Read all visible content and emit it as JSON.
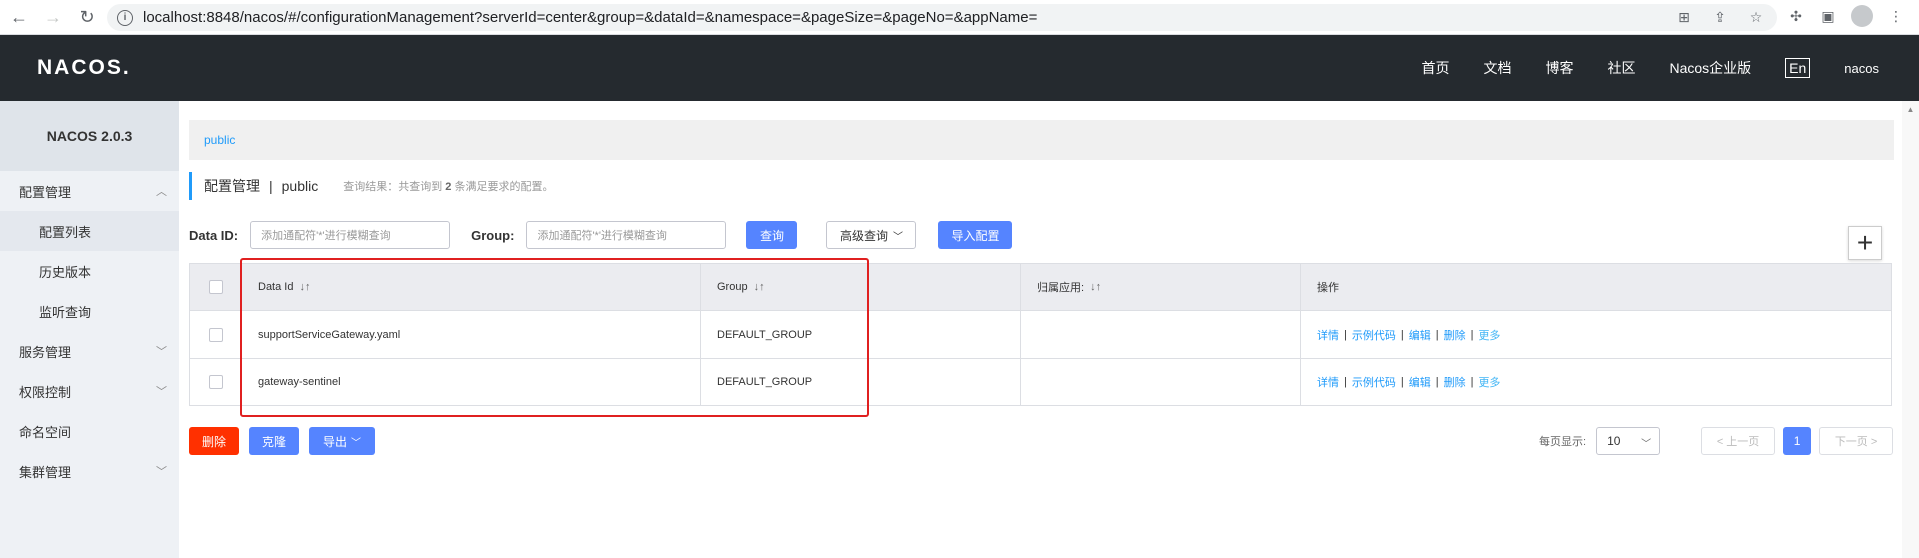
{
  "browser": {
    "url": "localhost:8848/nacos/#/configurationManagement?serverId=center&group=&dataId=&namespace=&pageSize=&pageNo=&appName=",
    "info_icon": "i"
  },
  "header": {
    "logo": "NACOS.",
    "nav": [
      "首页",
      "文档",
      "博客",
      "社区",
      "Nacos企业版"
    ],
    "lang": "En",
    "user": "nacos"
  },
  "sidebar": {
    "title": "NACOS 2.0.3",
    "items": [
      {
        "label": "配置管理"
      },
      {
        "label": "配置列表"
      },
      {
        "label": "历史版本"
      },
      {
        "label": "监听查询"
      },
      {
        "label": "服务管理"
      },
      {
        "label": "权限控制"
      },
      {
        "label": "命名空间"
      },
      {
        "label": "集群管理"
      }
    ]
  },
  "breadcrumb": {
    "namespace": "public"
  },
  "page": {
    "title": "配置管理",
    "separator": "|",
    "namespace": "public",
    "hint_prefix": "查询结果：共查询到",
    "hint_count": "2",
    "hint_suffix": "条满足要求的配置。"
  },
  "filter": {
    "dataid_label": "Data ID:",
    "dataid_placeholder": "添加通配符'*'进行模糊查询",
    "group_label": "Group:",
    "group_placeholder": "添加通配符'*'进行模糊查询",
    "query_btn": "查询",
    "advanced_btn": "高级查询",
    "import_btn": "导入配置",
    "add_btn": "+"
  },
  "table": {
    "headers": [
      "Data Id",
      "Group",
      "归属应用:",
      "操作"
    ],
    "sort_glyph": "↓↑",
    "rows": [
      {
        "data_id": "supportServiceGateway.yaml",
        "group": "DEFAULT_GROUP",
        "app": ""
      },
      {
        "data_id": "gateway-sentinel",
        "group": "DEFAULT_GROUP",
        "app": ""
      }
    ],
    "ops": [
      "详情",
      "示例代码",
      "编辑",
      "删除",
      "更多"
    ],
    "op_sep": "|"
  },
  "bottom": {
    "delete_btn": "删除",
    "clone_btn": "克隆",
    "export_btn": "导出"
  },
  "pager": {
    "page_size_label": "每页显示:",
    "page_size": "10",
    "prev": "< 上一页",
    "current": "1",
    "next": "下一页 >"
  },
  "colors": {
    "header_bg": "#252a2f",
    "primary": "#5584ff",
    "link": "#209bfa",
    "danger": "#ff3000",
    "highlight": "#e02020"
  }
}
